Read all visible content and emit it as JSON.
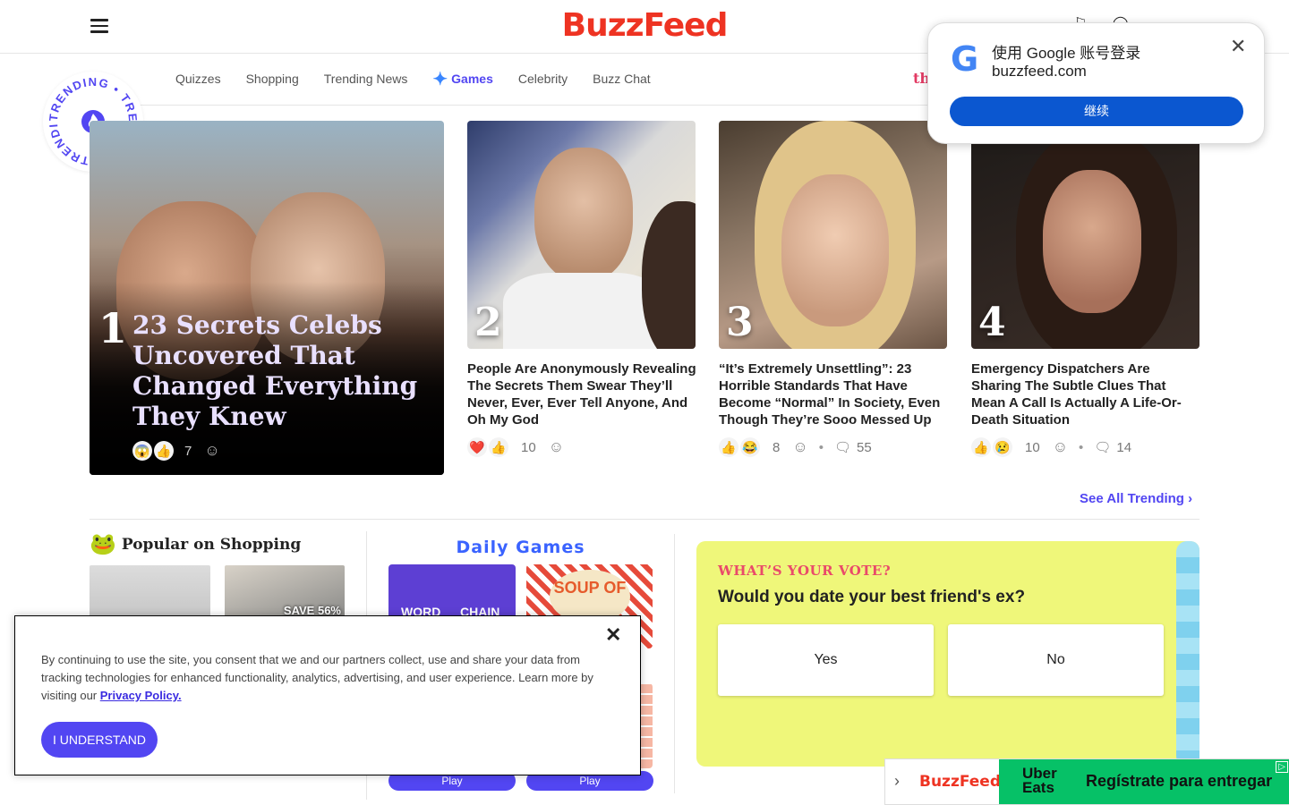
{
  "brand": {
    "logo": "BuzzFeed",
    "logo_color": "#ee3322",
    "accent": "#5246f2"
  },
  "nav": {
    "items": [
      "Quizzes",
      "Shopping",
      "Trending News",
      "Games",
      "Celebrity",
      "Buzz Chat"
    ],
    "active": "Games",
    "extra": "th"
  },
  "trending_badge": {
    "text": "TRENDING",
    "icon": "fire-icon"
  },
  "trending": [
    {
      "rank": "1",
      "title": "23 Secrets Celebs Uncovered That Changed Everything They Knew",
      "reactions": [
        "😱",
        "👍"
      ],
      "count": "7"
    },
    {
      "rank": "2",
      "title": "People Are Anonymously Revealing The Secrets Them Swear They’ll Never, Ever, Ever Tell Anyone, And Oh My God",
      "reactions": [
        "❤️",
        "👍"
      ],
      "count": "10"
    },
    {
      "rank": "3",
      "title": "“It’s Extremely Unsettling”: 23 Horrible Standards That Have Become “Normal” In Society, Even Though They’re Sooo Messed Up",
      "reactions": [
        "👍",
        "😂"
      ],
      "count": "8",
      "comments": "55"
    },
    {
      "rank": "4",
      "title": "Emergency Dispatchers Are Sharing The Subtle Clues That Mean A Call Is Actually A Life-Or-Death Situation",
      "reactions": [
        "👍",
        "😢"
      ],
      "count": "10",
      "comments": "14"
    }
  ],
  "see_all": "See All Trending",
  "shopping": {
    "title": "Popular on Shopping",
    "badge": "SAVE 56%"
  },
  "games": {
    "title": "Daily Games",
    "tiles": [
      "WORD",
      "CHAIN",
      "SOUP OF THE DAY"
    ],
    "play_label": "Play"
  },
  "vote": {
    "kicker": "WHAT’S YOUR VOTE?",
    "question": "Would you date your best friend's ex?",
    "options": [
      "Yes",
      "No"
    ]
  },
  "google_popup": {
    "line1": "使用 Google 账号登录",
    "line2": "buzzfeed.com",
    "button": "继续",
    "logo": "G"
  },
  "cookie": {
    "text": "By continuing to use the site, you consent that we and our partners collect, use and share your data from tracking technologies for enhanced functionality, analytics, advertising, and user experience. Learn more by visiting our",
    "link": "Privacy Policy.",
    "button": "I UNDERSTAND"
  },
  "ad": {
    "brand": "BuzzFeed",
    "partner": "Uber Eats",
    "cta": "Regístrate para entregar"
  }
}
